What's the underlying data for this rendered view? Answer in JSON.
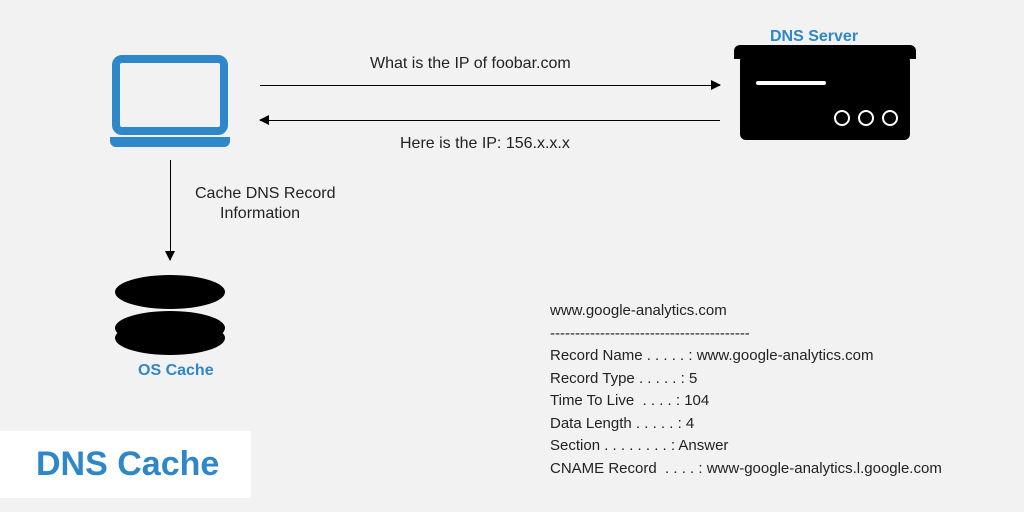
{
  "title": "DNS Cache",
  "nodes": {
    "client_label": "",
    "server_label": "DNS Server",
    "cache_label": "OS Cache"
  },
  "arrows": {
    "query": "What is the IP of foobar.com",
    "response": "Here is the IP: 156.x.x.x",
    "to_cache_line1": "Cache DNS Record",
    "to_cache_line2": "Information"
  },
  "record": {
    "host": "www.google-analytics.com",
    "sep": "----------------------------------------",
    "lines": [
      "Record Name . . . . . : www.google-analytics.com",
      "Record Type . . . . . : 5",
      "Time To Live  . . . . : 104",
      "Data Length . . . . . : 4",
      "Section . . . . . . . . : Answer",
      "CNAME Record  . . . . : www-google-analytics.l.google.com"
    ]
  }
}
